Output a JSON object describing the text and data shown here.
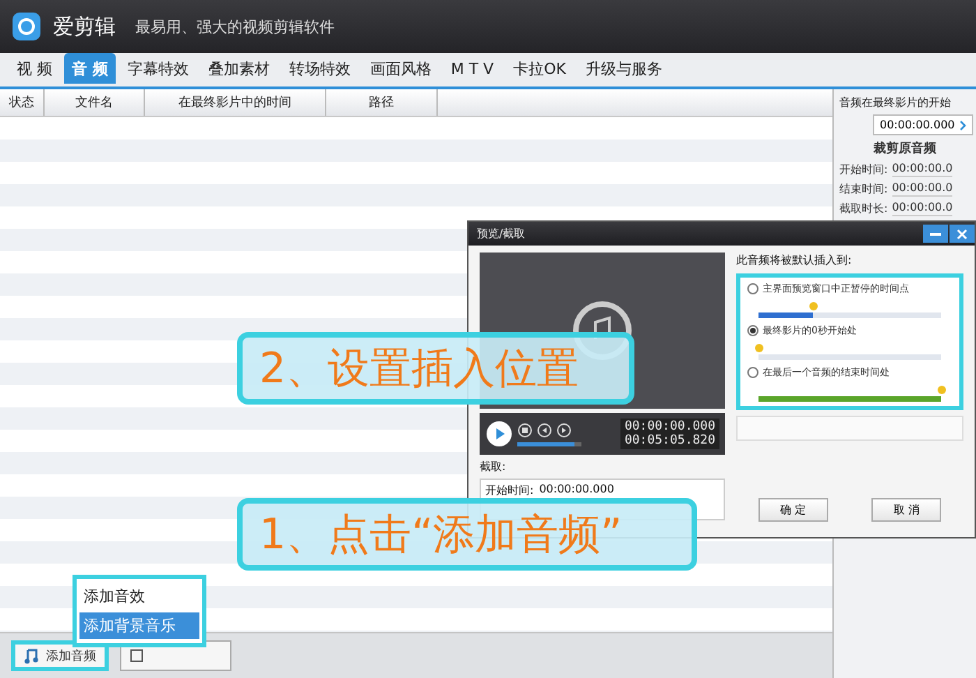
{
  "app": {
    "name": "爱剪辑",
    "slogan": "最易用、强大的视频剪辑软件"
  },
  "tabs": [
    {
      "label": "视 频",
      "selected": false
    },
    {
      "label": "音 频",
      "selected": true
    },
    {
      "label": "字幕特效",
      "selected": false
    },
    {
      "label": "叠加素材",
      "selected": false
    },
    {
      "label": "转场特效",
      "selected": false
    },
    {
      "label": "画面风格",
      "selected": false
    },
    {
      "label": "M T V",
      "selected": false
    },
    {
      "label": "卡拉OK",
      "selected": false
    },
    {
      "label": "升级与服务",
      "selected": false
    }
  ],
  "table": {
    "columns": [
      "状态",
      "文件名",
      "在最终影片中的时间",
      "路径"
    ]
  },
  "side_panel": {
    "title": "音频在最终影片的开始",
    "start_value": "00:00:00.000",
    "section": "裁剪原音频",
    "fields": [
      {
        "label": "开始时间:",
        "value": "00:00:00.0"
      },
      {
        "label": "结束时间:",
        "value": "00:00:00.0"
      },
      {
        "label": "截取时长:",
        "value": "00:00:00.0"
      }
    ]
  },
  "dialog": {
    "title": "预览/截取",
    "current_time": "00:00:00.000",
    "total_time": "00:05:05.820",
    "volume": {
      "level": 0.9
    },
    "clip_label": "截取:",
    "clip_start_label": "开始时间:",
    "clip_start_value": "00:00:00.000",
    "insert_heading": "此音频将被默认插入到:",
    "options": [
      {
        "label": "主界面预览窗口中正暂停的时间点",
        "selected": false,
        "kind": "blue",
        "level": 0.3
      },
      {
        "label": "最终影片的0秒开始处",
        "selected": true,
        "kind": "plain",
        "level": 0
      },
      {
        "label": "在最后一个音频的结束时间处",
        "selected": false,
        "kind": "green",
        "level": 1
      }
    ],
    "buttons": [
      "确 定",
      "取 消"
    ]
  },
  "callouts": [
    "2、设置插入位置",
    "1、点击“添加音频”"
  ],
  "menu": [
    {
      "label": "添加音效",
      "selected": false
    },
    {
      "label": "添加背景音乐",
      "selected": true
    }
  ],
  "bottom": {
    "add_button": "添加音频"
  }
}
